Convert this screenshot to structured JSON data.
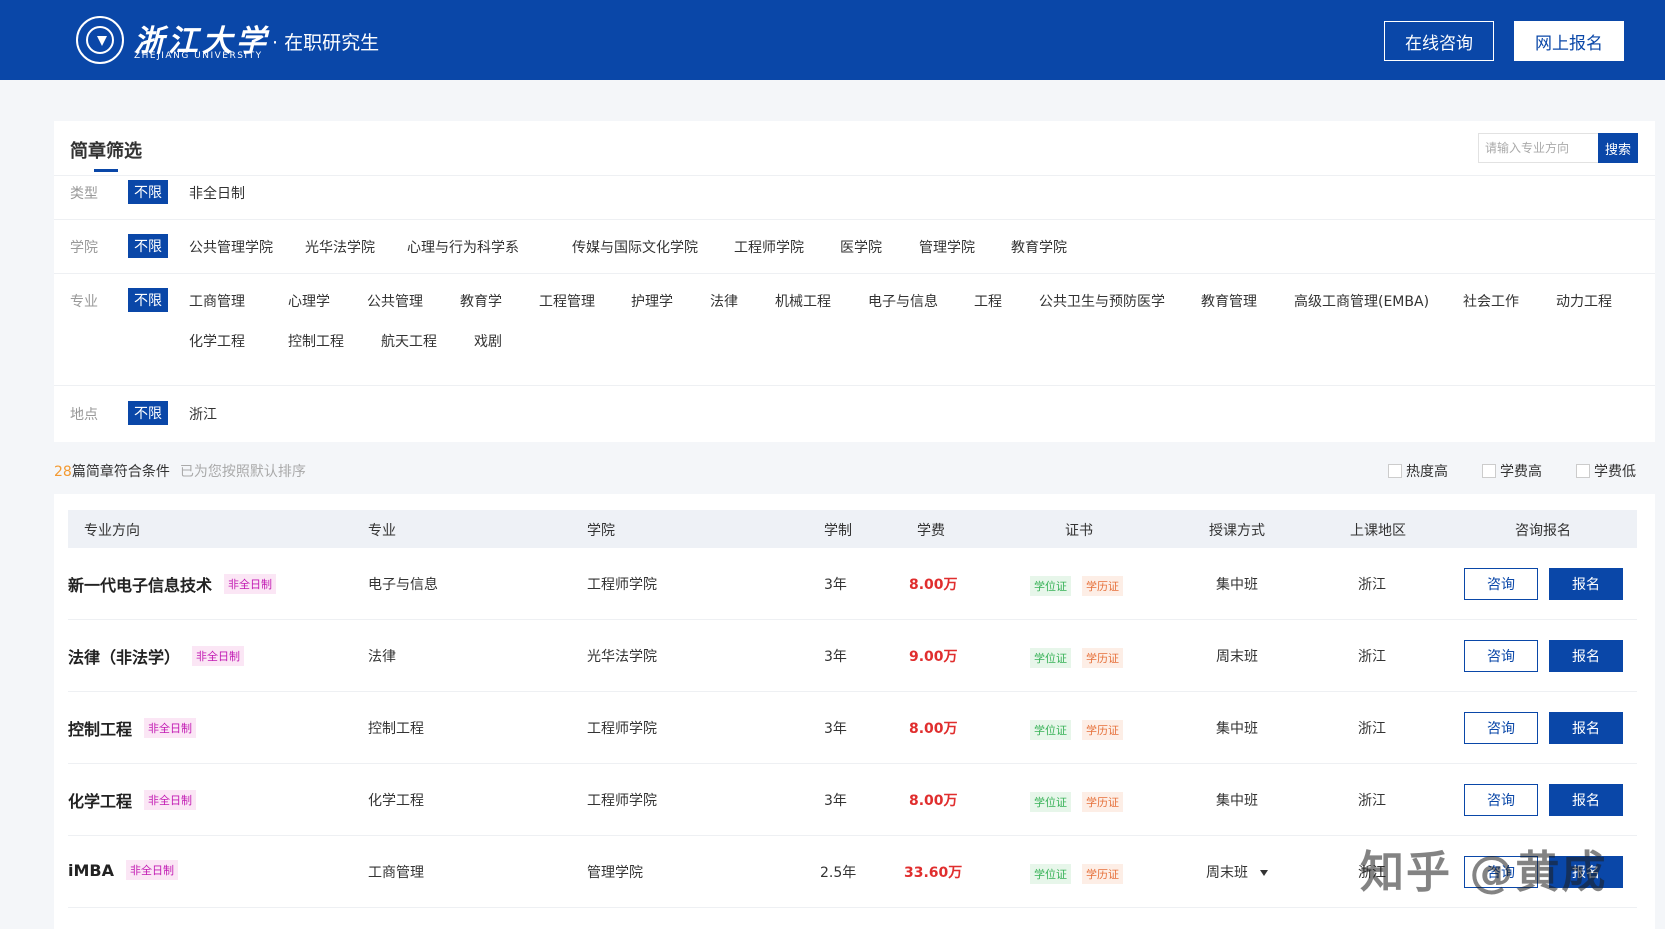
{
  "header": {
    "brand_name": "浙江大学",
    "brand_en": "ZHEJIANG UNIVERSITY",
    "subtitle": "· 在职研究生",
    "consult_label": "在线咨询",
    "apply_label": "网上报名",
    "bg_color": "#0a47a8"
  },
  "filter": {
    "title": "简章筛选",
    "search_placeholder": "请输入专业方向",
    "search_label": "搜索",
    "all_label": "不限",
    "rows": {
      "type": {
        "label": "类型",
        "options": [
          "非全日制"
        ]
      },
      "college": {
        "label": "学院",
        "options": [
          "公共管理学院",
          "光华法学院",
          "心理与行为科学系",
          "传媒与国际文化学院",
          "工程师学院",
          "医学院",
          "管理学院",
          "教育学院"
        ]
      },
      "major": {
        "label": "专业",
        "options": [
          "工商管理",
          "心理学",
          "公共管理",
          "教育学",
          "工程管理",
          "护理学",
          "法律",
          "机械工程",
          "电子与信息",
          "工程",
          "公共卫生与预防医学",
          "教育管理",
          "高级工商管理(EMBA)",
          "社会工作",
          "动力工程",
          "化学工程",
          "控制工程",
          "航天工程",
          "戏剧"
        ]
      },
      "location": {
        "label": "地点",
        "options": [
          "浙江"
        ]
      }
    }
  },
  "results": {
    "count": "28",
    "count_suffix": "篇简章符合条件",
    "sort_note": "已为您按照默认排序",
    "sort_options": [
      "热度高",
      "学费高",
      "学费低"
    ]
  },
  "table": {
    "headers": [
      "专业方向",
      "专业",
      "学院",
      "学制",
      "学费",
      "证书",
      "授课方式",
      "上课地区",
      "咨询报名"
    ],
    "consult_label": "咨询",
    "apply_label": "报名",
    "rows": [
      {
        "direction": "新一代电子信息技术",
        "badge": "非全日制",
        "major": "电子与信息",
        "college": "工程师学院",
        "duration": "3年",
        "fee": "8.00万",
        "cert_degree": "学位证",
        "cert_edu": "学历证",
        "mode": "集中班",
        "region": "浙江"
      },
      {
        "direction": "法律（非法学）",
        "badge": "非全日制",
        "major": "法律",
        "college": "光华法学院",
        "duration": "3年",
        "fee": "9.00万",
        "cert_degree": "学位证",
        "cert_edu": "学历证",
        "mode": "周末班",
        "region": "浙江"
      },
      {
        "direction": "控制工程",
        "badge": "非全日制",
        "major": "控制工程",
        "college": "工程师学院",
        "duration": "3年",
        "fee": "8.00万",
        "cert_degree": "学位证",
        "cert_edu": "学历证",
        "mode": "集中班",
        "region": "浙江"
      },
      {
        "direction": "化学工程",
        "badge": "非全日制",
        "major": "化学工程",
        "college": "工程师学院",
        "duration": "3年",
        "fee": "8.00万",
        "cert_degree": "学位证",
        "cert_edu": "学历证",
        "mode": "集中班",
        "region": "浙江"
      },
      {
        "direction": "iMBA",
        "badge": "非全日制",
        "major": "工商管理",
        "college": "管理学院",
        "duration": "2.5年",
        "fee": "33.60万",
        "cert_degree": "学位证",
        "cert_edu": "学历证",
        "mode": "周末班",
        "region": "浙江"
      }
    ]
  },
  "watermark": "知乎 @黄成",
  "colors": {
    "primary": "#0a47a8",
    "fee": "#e02e2e",
    "count": "#f39a32",
    "badge": "#c21ab3"
  }
}
